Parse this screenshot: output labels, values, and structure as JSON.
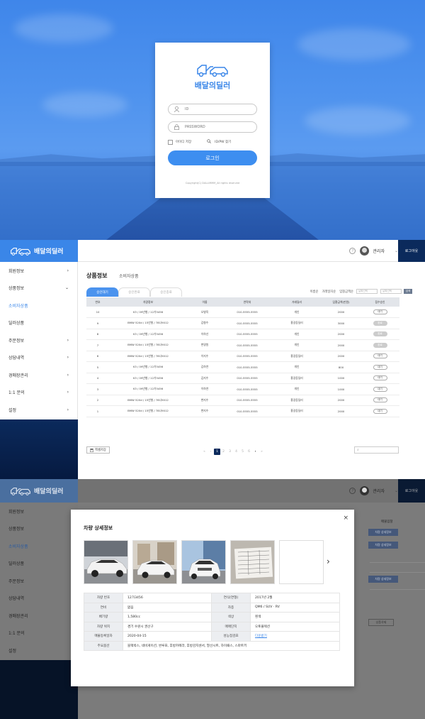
{
  "brand": {
    "name": "배달의딜러",
    "color": "#3a86e8"
  },
  "login": {
    "id_placeholder": "ID",
    "pw_placeholder": "PASSWORD",
    "remember_label": "아이디 저장",
    "find_label": "ID/PW 찾기",
    "login_button": "로그인",
    "copyright": "Copyright(C) DALLIMMM_All rights reserved"
  },
  "header": {
    "user": "관리자",
    "logout": "로그아웃",
    "help": "?"
  },
  "sidebar": {
    "items": [
      {
        "label": "회원정보",
        "chevron": "›"
      },
      {
        "label": "상품정보",
        "chevron": "⌄"
      },
      {
        "label": "소비자상품",
        "chevron": ""
      },
      {
        "label": "딜러상품",
        "chevron": ""
      },
      {
        "label": "주문정보",
        "chevron": "›"
      },
      {
        "label": "상담내역",
        "chevron": "›"
      },
      {
        "label": "경매장관리",
        "chevron": "›"
      },
      {
        "label": "1:1 문의",
        "chevron": "›"
      },
      {
        "label": "설정",
        "chevron": "›"
      }
    ]
  },
  "page": {
    "title": "상품정보",
    "subtitle": "소비자상품",
    "tabs": [
      "승인대기",
      "승인완료",
      "승인종료"
    ],
    "filters": [
      "이름순",
      "거래일자순",
      "입찰금액순"
    ],
    "date_from": "날짜선택",
    "date_to": "날짜선택",
    "search_btn": "검색",
    "excel": "엑셀저장",
    "search_icon": "⌕"
  },
  "table": {
    "headers": [
      "번호",
      "차량정보",
      "이름",
      "연락처",
      "거래딜러",
      "입찰금액(만원)",
      "접수승인"
    ],
    "rows": [
      [
        "10",
        "K3 / 09년형 / 12가3456",
        "오병욱",
        "010-5555-5555",
        "개인",
        "2000",
        "대기"
      ],
      [
        "9",
        "BMW 520d / 15년형 / 78나9012",
        "김형수",
        "010-5555-5555",
        "홍길동딜러",
        "3000",
        "완료"
      ],
      [
        "8",
        "K3 / 09년형 / 12가3456",
        "이하선",
        "010-5555-5555",
        "개인",
        "2000",
        "완료"
      ],
      [
        "7",
        "BMW 520d / 15년형 / 78나9012",
        "변영원",
        "010-5555-5555",
        "개인",
        "2000",
        "완료"
      ],
      [
        "6",
        "BMW 520d / 15년형 / 78나9012",
        "이지수",
        "010-5555-5555",
        "홍길동딜러",
        "2000",
        "대기"
      ],
      [
        "5",
        "K3 / 09년형 / 12가3456",
        "김하연",
        "010-5555-5555",
        "개인",
        "800",
        "대기"
      ],
      [
        "4",
        "K3 / 09년형 / 12가3456",
        "김지수",
        "010-5555-5555",
        "홍길동딜러",
        "1000",
        "대기"
      ],
      [
        "3",
        "K3 / 09년형 / 12가3456",
        "이하연",
        "010-5555-5555",
        "개인",
        "1000",
        "대기"
      ],
      [
        "2",
        "BMW 520d / 15년형 / 78나9012",
        "변지수",
        "010-5555-5555",
        "홍길동딜러",
        "2000",
        "대기"
      ],
      [
        "1",
        "BMW 520d / 15년형 / 78나9012",
        "변지수",
        "010-5555-5555",
        "홍길동딜러",
        "2000",
        "대기"
      ]
    ]
  },
  "pager": {
    "first": "«",
    "prev": "‹",
    "pages": [
      "1",
      "2",
      "3",
      "4",
      "5",
      "6"
    ],
    "next": "›",
    "last": "»"
  },
  "background_page": {
    "bid_label": "매물입찰 ",
    "detail_button": "차량 상세정보",
    "outline_button": "상품삭제"
  },
  "modal": {
    "title": "차량 상세정보",
    "close": "×",
    "next": "›",
    "rows": [
      {
        "k1": "차량 번호",
        "v1": "12가3456",
        "k2": "연식(연형)",
        "v2": "2017년 2월"
      },
      {
        "k1": "연비",
        "v1": "없음",
        "k2": "차종",
        "v2": "QM6 / SUV · RV"
      },
      {
        "k1": "배기량",
        "v1": "1,580cc",
        "k2": "색상",
        "v2": "흰색"
      },
      {
        "k1": "차량 위치",
        "v1": "경기 수원시 권선구",
        "k2": "매매단지",
        "v2": "오토플렉션"
      },
      {
        "k1": "매물등록일자",
        "v1": "2020-04-15",
        "k2": "성능점검표",
        "v2": "다운받기"
      }
    ],
    "options_label": "주요옵션",
    "options_value": "블랙박스, 네비게이션, 썬루프, 후방카메라, 후방감지센서, 열선시트, 하이패스, 스마트키"
  }
}
